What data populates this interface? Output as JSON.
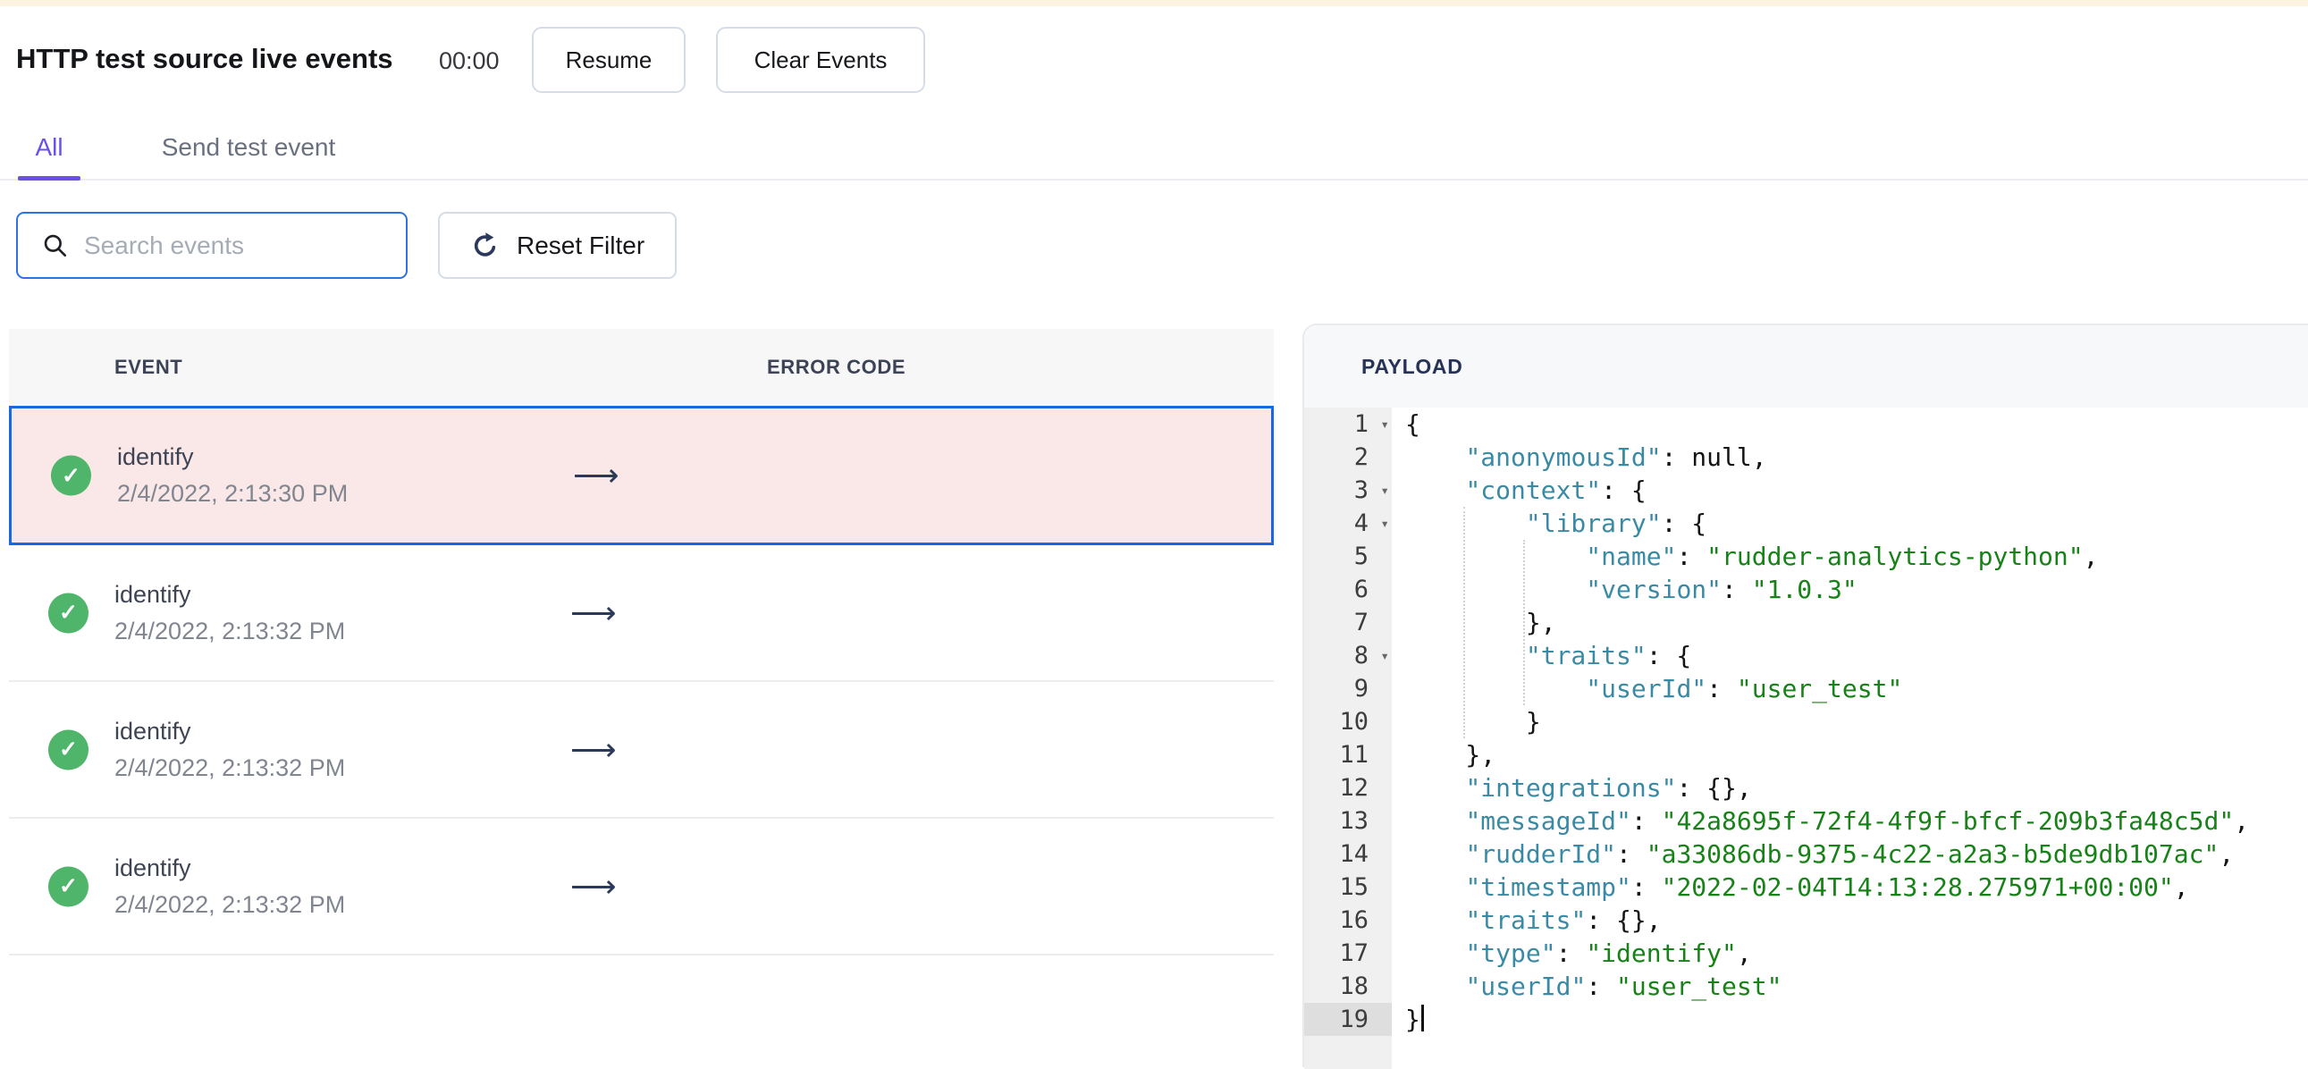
{
  "page": {
    "title": "HTTP test source live events",
    "timer": "00:00",
    "resume_label": "Resume",
    "clear_label": "Clear Events"
  },
  "tabs": [
    {
      "label": "All",
      "active": true
    },
    {
      "label": "Send test event",
      "active": false
    }
  ],
  "filters": {
    "search_placeholder": "Search events",
    "search_value": "",
    "reset_label": "Reset Filter"
  },
  "icons": {
    "check": "✓",
    "arrow": "⟶",
    "fold": "▾"
  },
  "colors": {
    "accent_tab": "#6c50e4",
    "selected_row_border": "#1668e3",
    "selected_row_bg": "#f9e8e7",
    "success_green": "#4eb56b",
    "search_focus_blue": "#2d71e6",
    "json_key": "#3a8aa5",
    "json_string": "#178217",
    "top_strip": "#fcf3e1"
  },
  "events_table": {
    "columns": [
      "EVENT",
      "ERROR CODE"
    ],
    "rows": [
      {
        "name": "identify",
        "timestamp": "2/4/2022, 2:13:30 PM",
        "status": "success",
        "selected": true
      },
      {
        "name": "identify",
        "timestamp": "2/4/2022, 2:13:32 PM",
        "status": "success",
        "selected": false
      },
      {
        "name": "identify",
        "timestamp": "2/4/2022, 2:13:32 PM",
        "status": "success",
        "selected": false
      },
      {
        "name": "identify",
        "timestamp": "2/4/2022, 2:13:32 PM",
        "status": "success",
        "selected": false
      }
    ]
  },
  "payload": {
    "title": "PAYLOAD",
    "lines": [
      {
        "num": 1,
        "fold": true,
        "parts": [
          [
            "p",
            "{"
          ]
        ]
      },
      {
        "num": 2,
        "parts": [
          [
            "p",
            "    "
          ],
          [
            "k",
            "\"anonymousId\""
          ],
          [
            "p",
            ": null,"
          ]
        ]
      },
      {
        "num": 3,
        "fold": true,
        "parts": [
          [
            "p",
            "    "
          ],
          [
            "k",
            "\"context\""
          ],
          [
            "p",
            ": {"
          ]
        ]
      },
      {
        "num": 4,
        "fold": true,
        "parts": [
          [
            "p",
            "        "
          ],
          [
            "k",
            "\"library\""
          ],
          [
            "p",
            ": {"
          ]
        ]
      },
      {
        "num": 5,
        "parts": [
          [
            "p",
            "            "
          ],
          [
            "k",
            "\"name\""
          ],
          [
            "p",
            ": "
          ],
          [
            "v",
            "\"rudder-analytics-python\""
          ],
          [
            "p",
            ","
          ]
        ]
      },
      {
        "num": 6,
        "parts": [
          [
            "p",
            "            "
          ],
          [
            "k",
            "\"version\""
          ],
          [
            "p",
            ": "
          ],
          [
            "v",
            "\"1.0.3\""
          ]
        ]
      },
      {
        "num": 7,
        "parts": [
          [
            "p",
            "        },"
          ]
        ]
      },
      {
        "num": 8,
        "fold": true,
        "parts": [
          [
            "p",
            "        "
          ],
          [
            "k",
            "\"traits\""
          ],
          [
            "p",
            ": {"
          ]
        ]
      },
      {
        "num": 9,
        "parts": [
          [
            "p",
            "            "
          ],
          [
            "k",
            "\"userId\""
          ],
          [
            "p",
            ": "
          ],
          [
            "v",
            "\"user_test\""
          ]
        ]
      },
      {
        "num": 10,
        "parts": [
          [
            "p",
            "        }"
          ]
        ]
      },
      {
        "num": 11,
        "parts": [
          [
            "p",
            "    },"
          ]
        ]
      },
      {
        "num": 12,
        "parts": [
          [
            "p",
            "    "
          ],
          [
            "k",
            "\"integrations\""
          ],
          [
            "p",
            ": {},"
          ]
        ]
      },
      {
        "num": 13,
        "parts": [
          [
            "p",
            "    "
          ],
          [
            "k",
            "\"messageId\""
          ],
          [
            "p",
            ": "
          ],
          [
            "v",
            "\"42a8695f-72f4-4f9f-bfcf-209b3fa48c5d\""
          ],
          [
            "p",
            ","
          ]
        ]
      },
      {
        "num": 14,
        "parts": [
          [
            "p",
            "    "
          ],
          [
            "k",
            "\"rudderId\""
          ],
          [
            "p",
            ": "
          ],
          [
            "v",
            "\"a33086db-9375-4c22-a2a3-b5de9db107ac\""
          ],
          [
            "p",
            ","
          ]
        ]
      },
      {
        "num": 15,
        "parts": [
          [
            "p",
            "    "
          ],
          [
            "k",
            "\"timestamp\""
          ],
          [
            "p",
            ": "
          ],
          [
            "v",
            "\"2022-02-04T14:13:28.275971+00:00\""
          ],
          [
            "p",
            ","
          ]
        ]
      },
      {
        "num": 16,
        "parts": [
          [
            "p",
            "    "
          ],
          [
            "k",
            "\"traits\""
          ],
          [
            "p",
            ": {},"
          ]
        ]
      },
      {
        "num": 17,
        "parts": [
          [
            "p",
            "    "
          ],
          [
            "k",
            "\"type\""
          ],
          [
            "p",
            ": "
          ],
          [
            "v",
            "\"identify\""
          ],
          [
            "p",
            ","
          ]
        ]
      },
      {
        "num": 18,
        "parts": [
          [
            "p",
            "    "
          ],
          [
            "k",
            "\"userId\""
          ],
          [
            "p",
            ": "
          ],
          [
            "v",
            "\"user_test\""
          ]
        ]
      },
      {
        "num": 19,
        "active": true,
        "caret": true,
        "parts": [
          [
            "p",
            "}"
          ]
        ]
      }
    ]
  }
}
